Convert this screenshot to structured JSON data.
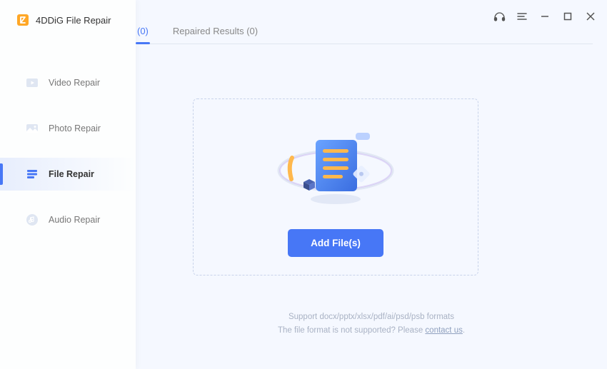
{
  "app": {
    "title": "4DDiG File Repair"
  },
  "sidebar": {
    "items": [
      {
        "label": "Video Repair"
      },
      {
        "label": "Photo Repair"
      },
      {
        "label": "File Repair"
      },
      {
        "label": "Audio Repair"
      }
    ]
  },
  "tabs": {
    "first_count": "(0)",
    "second_label": "Repaired Results (0)"
  },
  "dropzone": {
    "button_label": "Add File(s)"
  },
  "footer": {
    "line1": "Support docx/pptx/xlsx/pdf/ai/psd/psb formats",
    "line2_prefix": "The file format is not supported? Please ",
    "contact": "contact us",
    "period": "."
  }
}
